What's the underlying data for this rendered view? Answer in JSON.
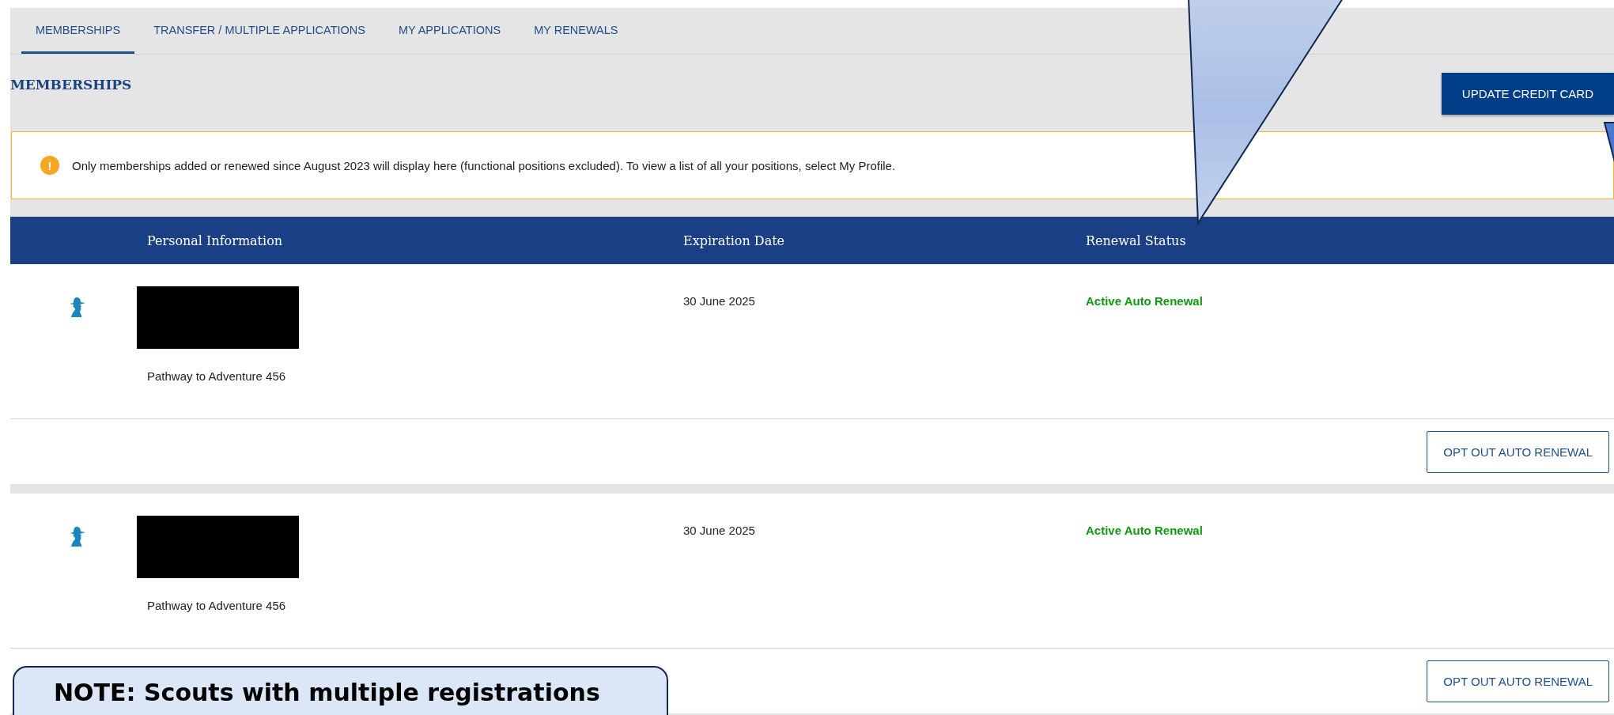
{
  "tabs": [
    {
      "label": "MEMBERSHIPS",
      "selected": true
    },
    {
      "label": "TRANSFER / MULTIPLE APPLICATIONS",
      "selected": false
    },
    {
      "label": "MY APPLICATIONS",
      "selected": false
    },
    {
      "label": "MY RENEWALS",
      "selected": false
    }
  ],
  "heading": "MEMBERSHIPS",
  "update_button": "UPDATE CREDIT CARD",
  "alert": {
    "icon": "!",
    "text": "Only memberships added or renewed since August 2023 will display here (functional positions excluded). To view a list of all your positions, select My Profile."
  },
  "table": {
    "columns": [
      "Personal Information",
      "Expiration Date",
      "Renewal Status"
    ],
    "rows": [
      {
        "redacted": true,
        "unit": "Pathway to Adventure 456",
        "expiration": "30 June 2025",
        "status": "Active Auto Renewal",
        "kind": "active",
        "action": "OPT OUT AUTO RENEWAL"
      },
      {
        "redacted": true,
        "unit": "Pathway to Adventure 456",
        "expiration": "30 June 2025",
        "status": "Active Auto Renewal",
        "kind": "active",
        "action": "OPT OUT AUTO RENEWAL"
      }
    ]
  },
  "note": {
    "text": "NOTE: Scouts with multiple registrations"
  }
}
